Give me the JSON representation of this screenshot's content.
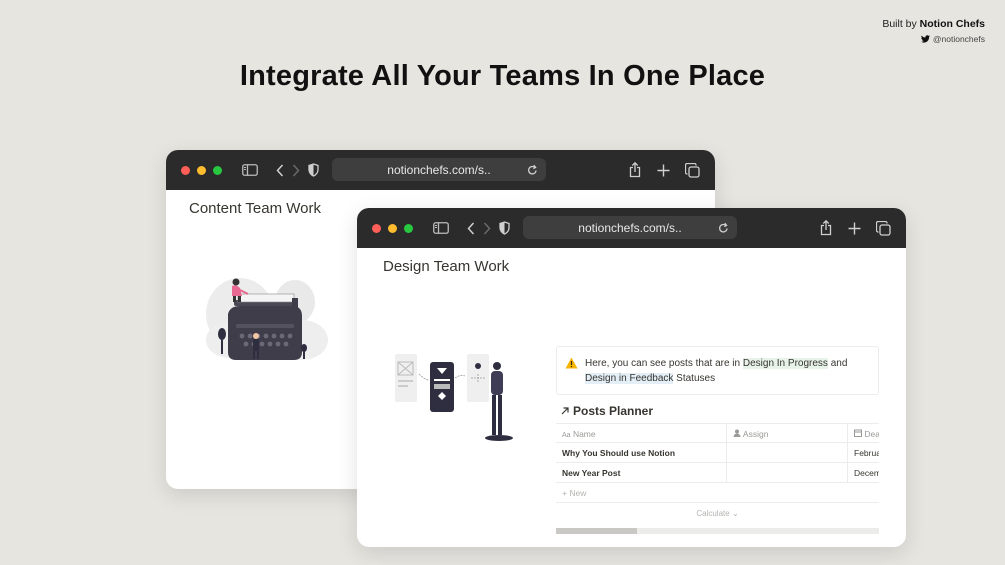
{
  "credit": {
    "built_by": "Built by",
    "brand": "Notion Chefs",
    "handle": "@notionchefs"
  },
  "headline": "Integrate All Your Teams In One Place",
  "windows": {
    "back": {
      "url": "notionchefs.com/s..",
      "page_title": "Content Team Work"
    },
    "front": {
      "url": "notionchefs.com/s..",
      "page_title": "Design Team Work",
      "callout": {
        "icon": "warning-icon",
        "text_before": "Here, you can see posts that are in ",
        "tag1": "Design In Progress",
        "text_mid": " and ",
        "tag2": "Design in Feedback",
        "text_after": " Statuses"
      },
      "database": {
        "title": "Posts Planner",
        "columns": [
          "Name",
          "Assign",
          "Dea"
        ],
        "rows": [
          {
            "name": "Why You Should use Notion",
            "assign": "",
            "date": "Februa"
          },
          {
            "name": "New Year Post",
            "assign": "",
            "date": "Decem"
          }
        ],
        "new_label": "New",
        "calculate_label": "Calculate",
        "scroll_fraction": 0.25
      }
    }
  },
  "colors": {
    "background": "#e7e5e0",
    "toolbar": "#2b2b2b",
    "traffic_red": "#ff5f57",
    "traffic_yellow": "#febc2e",
    "traffic_green": "#28c840"
  }
}
